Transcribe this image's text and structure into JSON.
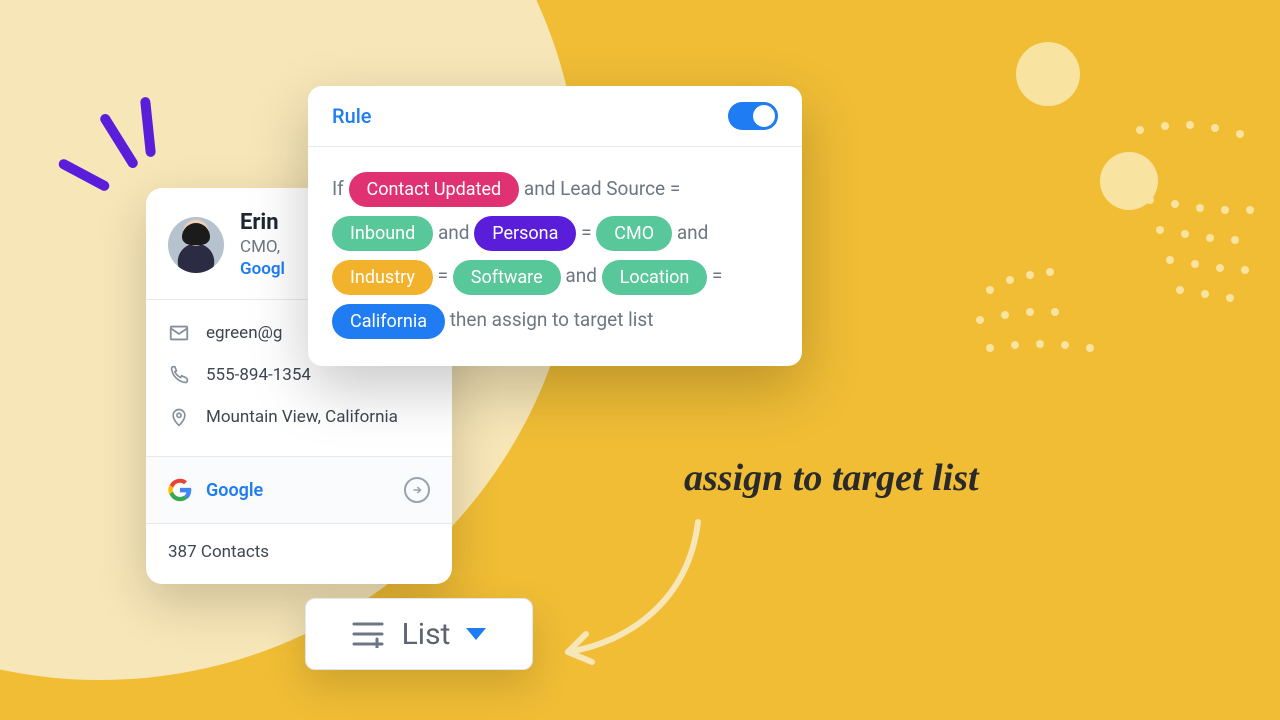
{
  "colors": {
    "accent_blue": "#1f7cf2",
    "chip_pink": "#e03173",
    "chip_green": "#58c79a",
    "chip_purple": "#5a1edb",
    "chip_amber": "#f3b22c",
    "bg_yellow": "#f0bd35",
    "bg_cream": "#f7e6b7"
  },
  "contact": {
    "name": "Erin",
    "title": "CMO,",
    "company_link": "Googl",
    "email": "egreen@g",
    "phone": "555-894-1354",
    "location": "Mountain View, California"
  },
  "company_row": {
    "name": "Google"
  },
  "footer": {
    "count_text": "387 Contacts"
  },
  "rule_panel": {
    "title": "Rule",
    "toggle_on": true,
    "tokens": {
      "If": "If",
      "and": "and",
      "eq": "=",
      "lead_source": "Lead Source",
      "then": "then assign to target list"
    },
    "chips": {
      "contact_updated": "Contact Updated",
      "inbound": "Inbound",
      "persona": "Persona",
      "cmo": "CMO",
      "industry": "Industry",
      "software": "Software",
      "location": "Location",
      "california": "California"
    }
  },
  "list_widget": {
    "label": "List"
  },
  "handwriting": "assign to target list"
}
